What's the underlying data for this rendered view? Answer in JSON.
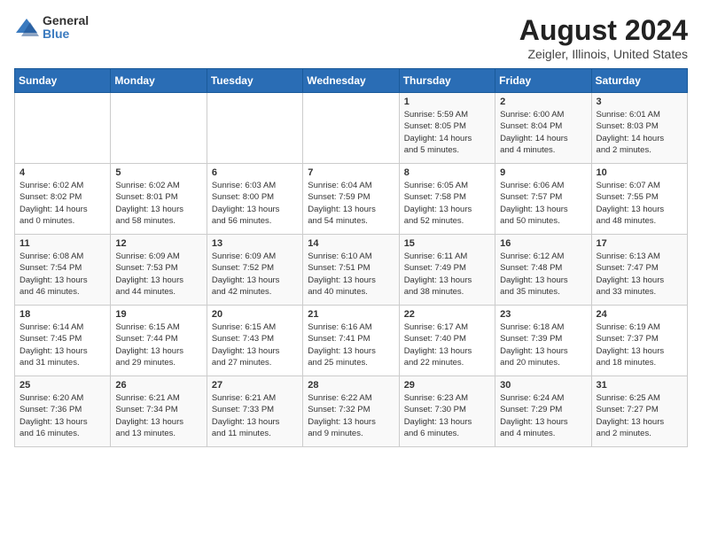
{
  "header": {
    "logo_general": "General",
    "logo_blue": "Blue",
    "title": "August 2024",
    "subtitle": "Zeigler, Illinois, United States"
  },
  "weekdays": [
    "Sunday",
    "Monday",
    "Tuesday",
    "Wednesday",
    "Thursday",
    "Friday",
    "Saturday"
  ],
  "weeks": [
    [
      {
        "day": "",
        "info": ""
      },
      {
        "day": "",
        "info": ""
      },
      {
        "day": "",
        "info": ""
      },
      {
        "day": "",
        "info": ""
      },
      {
        "day": "1",
        "info": "Sunrise: 5:59 AM\nSunset: 8:05 PM\nDaylight: 14 hours\nand 5 minutes."
      },
      {
        "day": "2",
        "info": "Sunrise: 6:00 AM\nSunset: 8:04 PM\nDaylight: 14 hours\nand 4 minutes."
      },
      {
        "day": "3",
        "info": "Sunrise: 6:01 AM\nSunset: 8:03 PM\nDaylight: 14 hours\nand 2 minutes."
      }
    ],
    [
      {
        "day": "4",
        "info": "Sunrise: 6:02 AM\nSunset: 8:02 PM\nDaylight: 14 hours\nand 0 minutes."
      },
      {
        "day": "5",
        "info": "Sunrise: 6:02 AM\nSunset: 8:01 PM\nDaylight: 13 hours\nand 58 minutes."
      },
      {
        "day": "6",
        "info": "Sunrise: 6:03 AM\nSunset: 8:00 PM\nDaylight: 13 hours\nand 56 minutes."
      },
      {
        "day": "7",
        "info": "Sunrise: 6:04 AM\nSunset: 7:59 PM\nDaylight: 13 hours\nand 54 minutes."
      },
      {
        "day": "8",
        "info": "Sunrise: 6:05 AM\nSunset: 7:58 PM\nDaylight: 13 hours\nand 52 minutes."
      },
      {
        "day": "9",
        "info": "Sunrise: 6:06 AM\nSunset: 7:57 PM\nDaylight: 13 hours\nand 50 minutes."
      },
      {
        "day": "10",
        "info": "Sunrise: 6:07 AM\nSunset: 7:55 PM\nDaylight: 13 hours\nand 48 minutes."
      }
    ],
    [
      {
        "day": "11",
        "info": "Sunrise: 6:08 AM\nSunset: 7:54 PM\nDaylight: 13 hours\nand 46 minutes."
      },
      {
        "day": "12",
        "info": "Sunrise: 6:09 AM\nSunset: 7:53 PM\nDaylight: 13 hours\nand 44 minutes."
      },
      {
        "day": "13",
        "info": "Sunrise: 6:09 AM\nSunset: 7:52 PM\nDaylight: 13 hours\nand 42 minutes."
      },
      {
        "day": "14",
        "info": "Sunrise: 6:10 AM\nSunset: 7:51 PM\nDaylight: 13 hours\nand 40 minutes."
      },
      {
        "day": "15",
        "info": "Sunrise: 6:11 AM\nSunset: 7:49 PM\nDaylight: 13 hours\nand 38 minutes."
      },
      {
        "day": "16",
        "info": "Sunrise: 6:12 AM\nSunset: 7:48 PM\nDaylight: 13 hours\nand 35 minutes."
      },
      {
        "day": "17",
        "info": "Sunrise: 6:13 AM\nSunset: 7:47 PM\nDaylight: 13 hours\nand 33 minutes."
      }
    ],
    [
      {
        "day": "18",
        "info": "Sunrise: 6:14 AM\nSunset: 7:45 PM\nDaylight: 13 hours\nand 31 minutes."
      },
      {
        "day": "19",
        "info": "Sunrise: 6:15 AM\nSunset: 7:44 PM\nDaylight: 13 hours\nand 29 minutes."
      },
      {
        "day": "20",
        "info": "Sunrise: 6:15 AM\nSunset: 7:43 PM\nDaylight: 13 hours\nand 27 minutes."
      },
      {
        "day": "21",
        "info": "Sunrise: 6:16 AM\nSunset: 7:41 PM\nDaylight: 13 hours\nand 25 minutes."
      },
      {
        "day": "22",
        "info": "Sunrise: 6:17 AM\nSunset: 7:40 PM\nDaylight: 13 hours\nand 22 minutes."
      },
      {
        "day": "23",
        "info": "Sunrise: 6:18 AM\nSunset: 7:39 PM\nDaylight: 13 hours\nand 20 minutes."
      },
      {
        "day": "24",
        "info": "Sunrise: 6:19 AM\nSunset: 7:37 PM\nDaylight: 13 hours\nand 18 minutes."
      }
    ],
    [
      {
        "day": "25",
        "info": "Sunrise: 6:20 AM\nSunset: 7:36 PM\nDaylight: 13 hours\nand 16 minutes."
      },
      {
        "day": "26",
        "info": "Sunrise: 6:21 AM\nSunset: 7:34 PM\nDaylight: 13 hours\nand 13 minutes."
      },
      {
        "day": "27",
        "info": "Sunrise: 6:21 AM\nSunset: 7:33 PM\nDaylight: 13 hours\nand 11 minutes."
      },
      {
        "day": "28",
        "info": "Sunrise: 6:22 AM\nSunset: 7:32 PM\nDaylight: 13 hours\nand 9 minutes."
      },
      {
        "day": "29",
        "info": "Sunrise: 6:23 AM\nSunset: 7:30 PM\nDaylight: 13 hours\nand 6 minutes."
      },
      {
        "day": "30",
        "info": "Sunrise: 6:24 AM\nSunset: 7:29 PM\nDaylight: 13 hours\nand 4 minutes."
      },
      {
        "day": "31",
        "info": "Sunrise: 6:25 AM\nSunset: 7:27 PM\nDaylight: 13 hours\nand 2 minutes."
      }
    ]
  ]
}
